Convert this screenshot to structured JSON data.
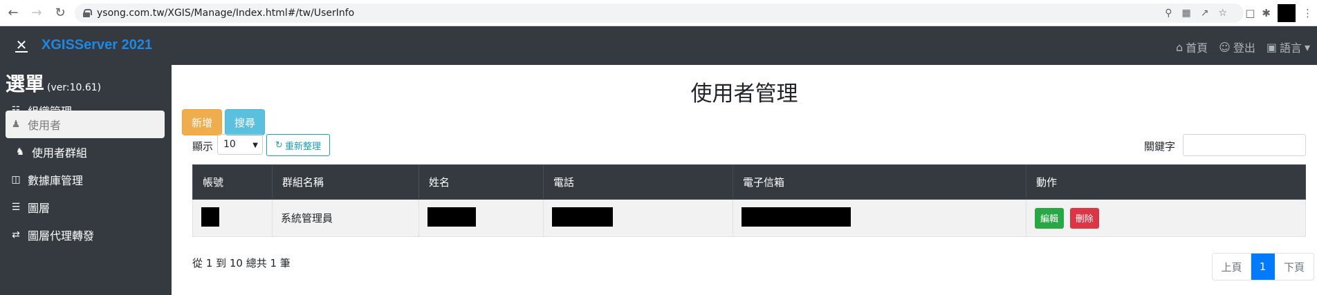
{
  "browser": {
    "url": "ysong.com.tw/XGIS/Manage/Index.html#/tw/UserInfo"
  },
  "navbar": {
    "brand": "XGISServer 2021",
    "home": "首頁",
    "logout": "登出",
    "language": "語言"
  },
  "sidebar": {
    "title": "選單",
    "version": "(ver:10.61)",
    "items": [
      {
        "label": "組織管理",
        "icon": "sitemap-icon"
      },
      {
        "label": "使用者",
        "icon": "user-icon"
      },
      {
        "label": "使用者群組",
        "icon": "users-icon"
      },
      {
        "label": "數據庫管理",
        "icon": "database-icon"
      },
      {
        "label": "圖層",
        "icon": "layers-icon"
      },
      {
        "label": "圖層代理轉發",
        "icon": "exchange-icon"
      }
    ]
  },
  "main": {
    "title": "使用者管理",
    "add_label": "新增",
    "search_label": "搜尋",
    "show_label": "顯示",
    "page_size": "10",
    "refresh_label": "重新整理",
    "keyword_label": "關鍵字",
    "table": {
      "headers": [
        "帳號",
        "群組名稱",
        "姓名",
        "電話",
        "電子信箱",
        "動作"
      ],
      "rows": [
        {
          "group": "系統管理員",
          "edit": "編輯",
          "delete": "刪除"
        }
      ]
    },
    "summary": "從 1 到 10 總共 1 筆",
    "pager": {
      "prev": "上頁",
      "current": "1",
      "next": "下頁"
    }
  },
  "colors": {
    "navbar": "#343a40",
    "brand": "#1e88e5",
    "add": "#f0ad4e",
    "search": "#5bc0de",
    "edit": "#28a745",
    "delete": "#dc3545",
    "active_page": "#007bff"
  }
}
